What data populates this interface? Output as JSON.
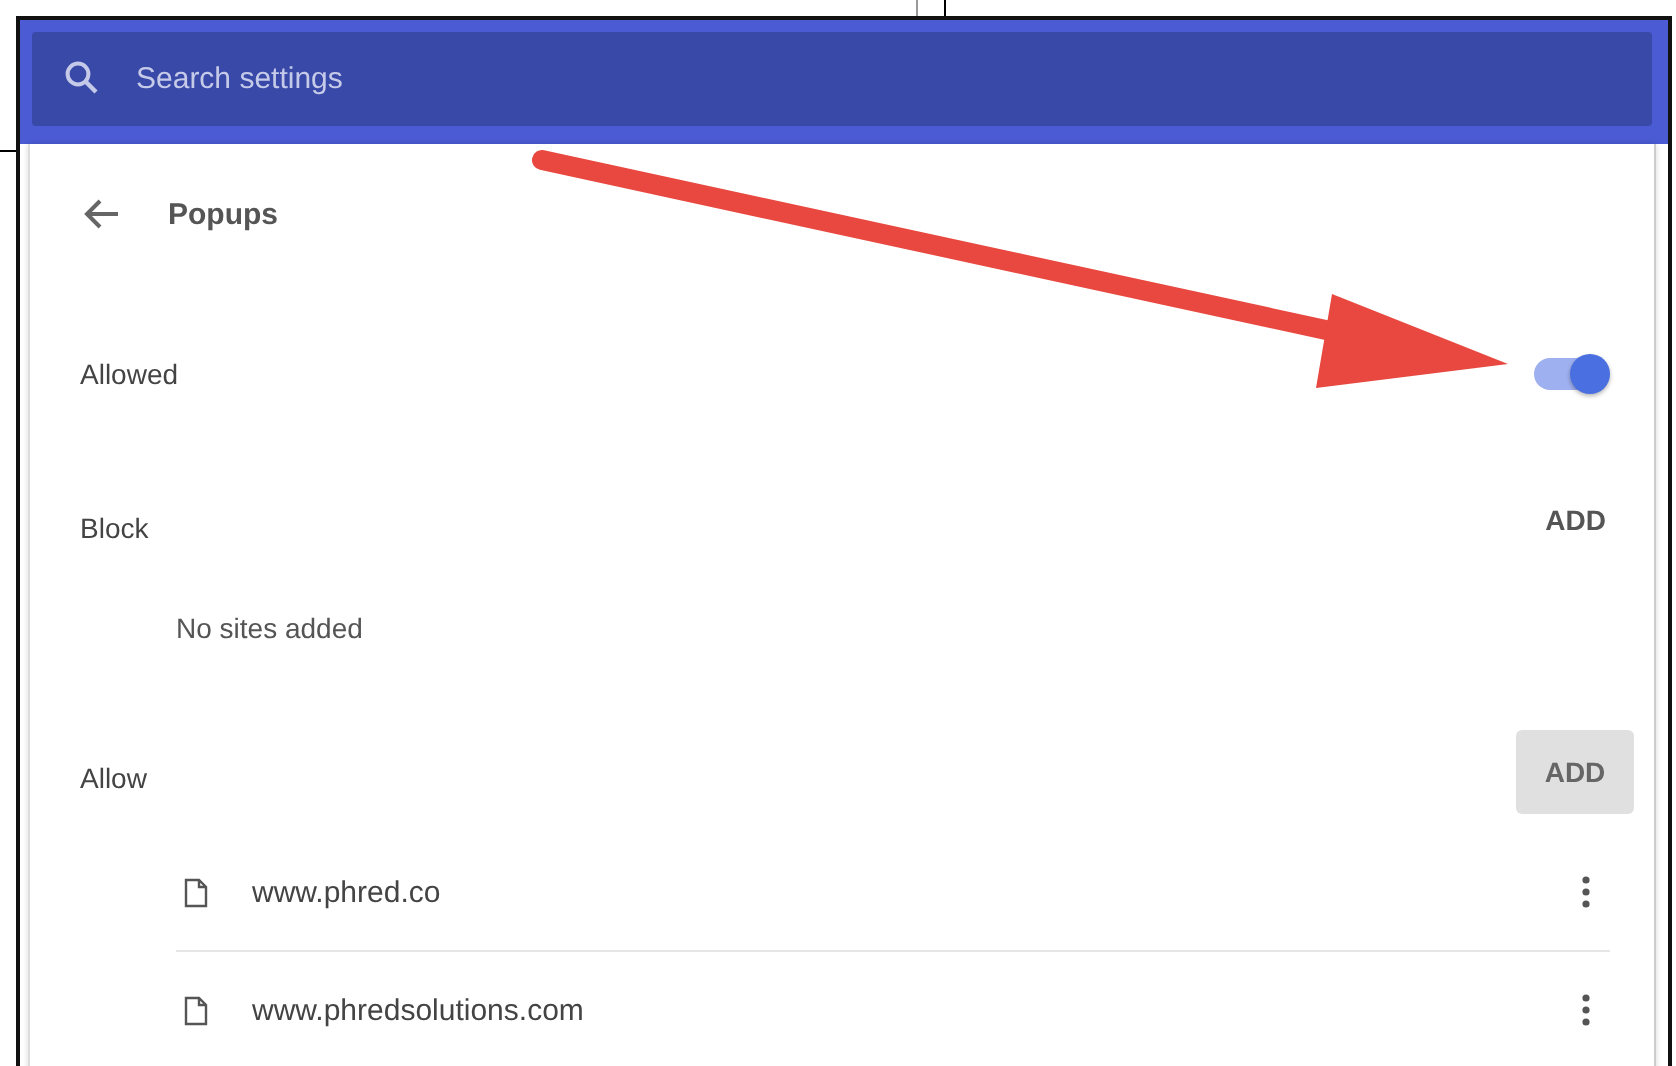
{
  "search": {
    "placeholder": "Search settings"
  },
  "page_title": "Popups",
  "allowed": {
    "label": "Allowed",
    "on": true
  },
  "block": {
    "label": "Block",
    "add_button": "ADD",
    "empty_text": "No sites added"
  },
  "allow": {
    "label": "Allow",
    "add_button": "ADD",
    "sites": [
      {
        "name": "www.phred.co"
      },
      {
        "name": "www.phredsolutions.com"
      }
    ]
  }
}
